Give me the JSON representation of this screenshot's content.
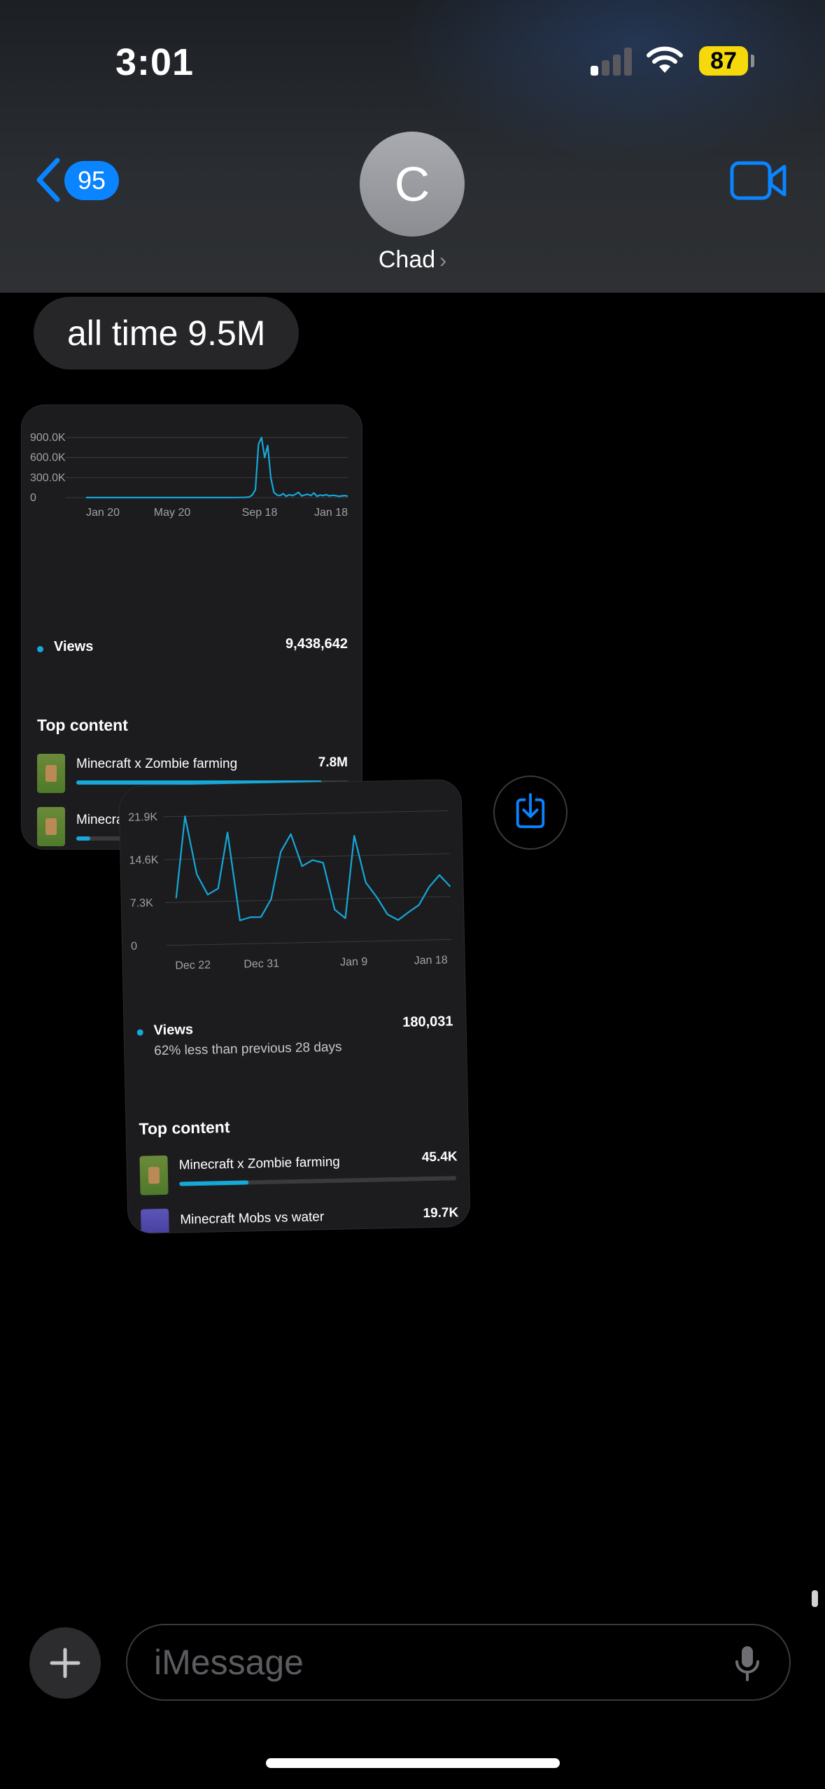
{
  "status_bar": {
    "time": "3:01",
    "battery": "87"
  },
  "header": {
    "back_count": "95",
    "avatar_initial": "C",
    "contact_name": "Chad"
  },
  "messages": {
    "text": "all time 9.5M"
  },
  "card1": {
    "y_ticks": [
      "900.0K",
      "600.0K",
      "300.0K",
      "0"
    ],
    "x_ticks": [
      "Jan 20",
      "May 20",
      "Sep 18",
      "Jan 18"
    ],
    "views_label": "Views",
    "views_value": "9,438,642",
    "top_content_title": "Top content",
    "items": [
      {
        "name": "Minecraft x Zombie farming",
        "value": "7.8M",
        "fraction": 0.9
      },
      {
        "name": "Minecra",
        "value": "",
        "fraction": 0.05
      }
    ]
  },
  "card2": {
    "y_ticks": [
      "21.9K",
      "14.6K",
      "7.3K",
      "0"
    ],
    "x_ticks": [
      "Dec 22",
      "Dec 31",
      "Jan 9",
      "Jan 18"
    ],
    "views_label": "Views",
    "views_value": "180,031",
    "views_subtext": "62% less than previous 28 days",
    "top_content_title": "Top content",
    "items": [
      {
        "name": "Minecraft x Zombie farming",
        "value": "45.4K",
        "fraction": 0.25
      },
      {
        "name": "Minecraft Mobs vs water",
        "value": "19.7K",
        "fraction": 0.11
      }
    ]
  },
  "chart_data": [
    {
      "type": "line",
      "title": "",
      "xlabel": "",
      "ylabel": "",
      "series": [
        {
          "name": "Views",
          "color": "#15a8d8",
          "values": [
            1000,
            1000,
            1000,
            1000,
            1000,
            1000,
            1000,
            1000,
            1000,
            1000,
            1000,
            1000,
            1000,
            1000,
            1000,
            1000,
            1000,
            1000,
            1000,
            1000,
            1000,
            1000,
            1000,
            1000,
            1000,
            1000,
            1000,
            1000,
            1000,
            1000,
            1000,
            1000,
            1000,
            1000,
            1000,
            1000,
            1000,
            1000,
            1000,
            1000,
            1000,
            1000,
            1000,
            1000,
            1000,
            1000,
            1000,
            1000,
            2000,
            2000,
            3000,
            3000,
            5000,
            10000,
            40000,
            120000,
            800000,
            900000,
            600000,
            780000,
            300000,
            80000,
            40000,
            30000,
            60000,
            20000,
            45000,
            30000,
            50000,
            80000,
            25000,
            40000,
            50000,
            30000,
            70000,
            20000,
            40000,
            30000,
            45000,
            25000,
            35000,
            30000,
            20000,
            25000,
            30000,
            20000
          ]
        }
      ],
      "x_tick_labels": [
        "Jan 20",
        "May 20",
        "Sep 18",
        "Jan 18"
      ],
      "ylim": [
        0,
        900000
      ],
      "grid": true
    },
    {
      "type": "line",
      "title": "",
      "xlabel": "",
      "ylabel": "",
      "series": [
        {
          "name": "Views",
          "color": "#15a8d8",
          "values": [
            8000,
            21900,
            12000,
            8500,
            9500,
            19000,
            4000,
            4500,
            4500,
            7500,
            15500,
            18500,
            13000,
            14000,
            13500,
            5500,
            4000,
            18000,
            10000,
            7500,
            4500,
            3500,
            4800,
            6000,
            9000,
            11000,
            9000
          ]
        }
      ],
      "x_tick_labels": [
        "Dec 22",
        "Dec 31",
        "Jan 9",
        "Jan 18"
      ],
      "ylim": [
        0,
        21900
      ],
      "grid": true
    }
  ]
}
